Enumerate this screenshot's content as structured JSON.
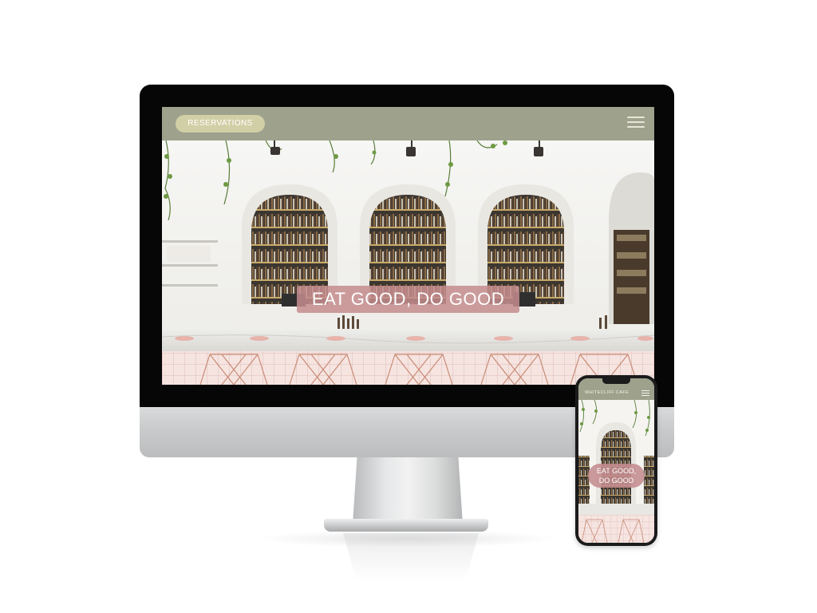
{
  "desktop": {
    "header": {
      "reservations_label": "RESERVATIONS",
      "menu_icon": "hamburger-icon"
    },
    "hero": {
      "tagline": "EAT GOOD, DO GOOD"
    }
  },
  "mobile": {
    "header": {
      "brand": "WHITECLIFF CAFE",
      "menu_icon": "hamburger-icon"
    },
    "hero": {
      "tagline_line1": "EAT GOOD,",
      "tagline_line2": "DO GOOD"
    }
  },
  "colors": {
    "header_bg": "#9ea18c",
    "button_bg": "#d1cfa6",
    "tagline_bg": "#c48c8e",
    "bezel": "#060606"
  }
}
